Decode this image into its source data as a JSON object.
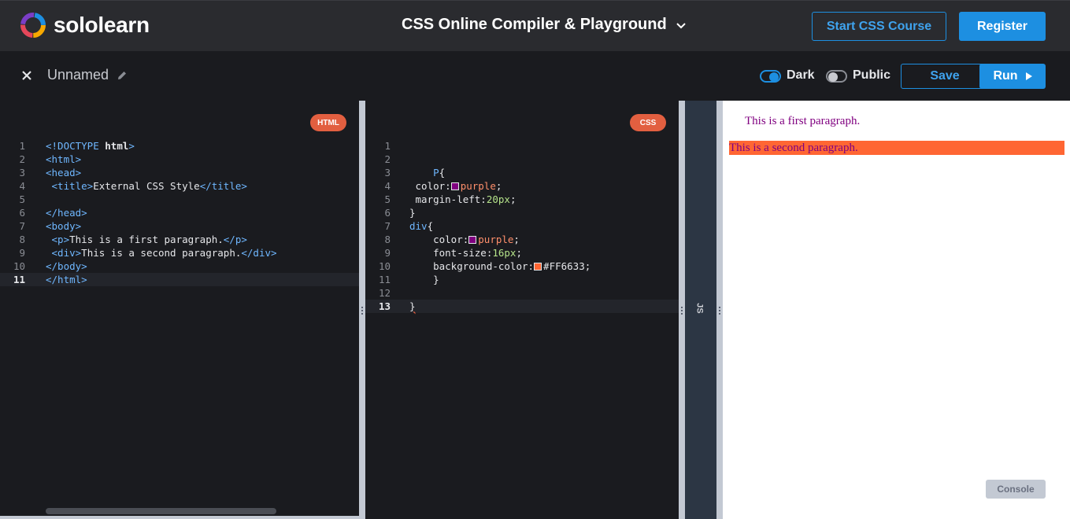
{
  "header": {
    "brand": "sololearn",
    "title": "CSS Online Compiler & Playground",
    "start_course_label": "Start CSS Course",
    "register_label": "Register"
  },
  "toolbar": {
    "project_name": "Unnamed",
    "dark_label": "Dark",
    "dark_on": true,
    "public_label": "Public",
    "public_on": false,
    "save_label": "Save",
    "run_label": "Run"
  },
  "html_pane": {
    "badge": "HTML",
    "lines": [
      "<!DOCTYPE html>",
      "<html>",
      "<head>",
      " <title>External CSS Style</title>",
      "",
      "</head>",
      "<body>",
      " <p>This is a first paragraph.</p>",
      " <div>This is a second paragraph.</div>",
      "</body>",
      "</html>"
    ],
    "active_line": 11
  },
  "css_pane": {
    "badge": "CSS",
    "lines": [
      "",
      "",
      "    P{",
      " color: purple;",
      " margin-left:20px;",
      "}",
      "div{",
      "    color: purple;",
      "    font-size:16px;",
      "    background-color: #FF6633;",
      "    }",
      "",
      "}"
    ],
    "active_line": 13
  },
  "js_pane": {
    "label": "JS"
  },
  "output": {
    "paragraph_1": "This is a first paragraph.",
    "paragraph_2": "This is a second paragraph.",
    "console_label": "Console"
  },
  "colors": {
    "accent": "#1d8fe1",
    "badge": "#e25f40",
    "purple_swatch": "#800080",
    "orange_swatch": "#FF6633"
  },
  "icons": [
    "sololearn-logo-icon",
    "chevron-down-icon",
    "close-icon",
    "pencil-icon",
    "play-icon"
  ]
}
